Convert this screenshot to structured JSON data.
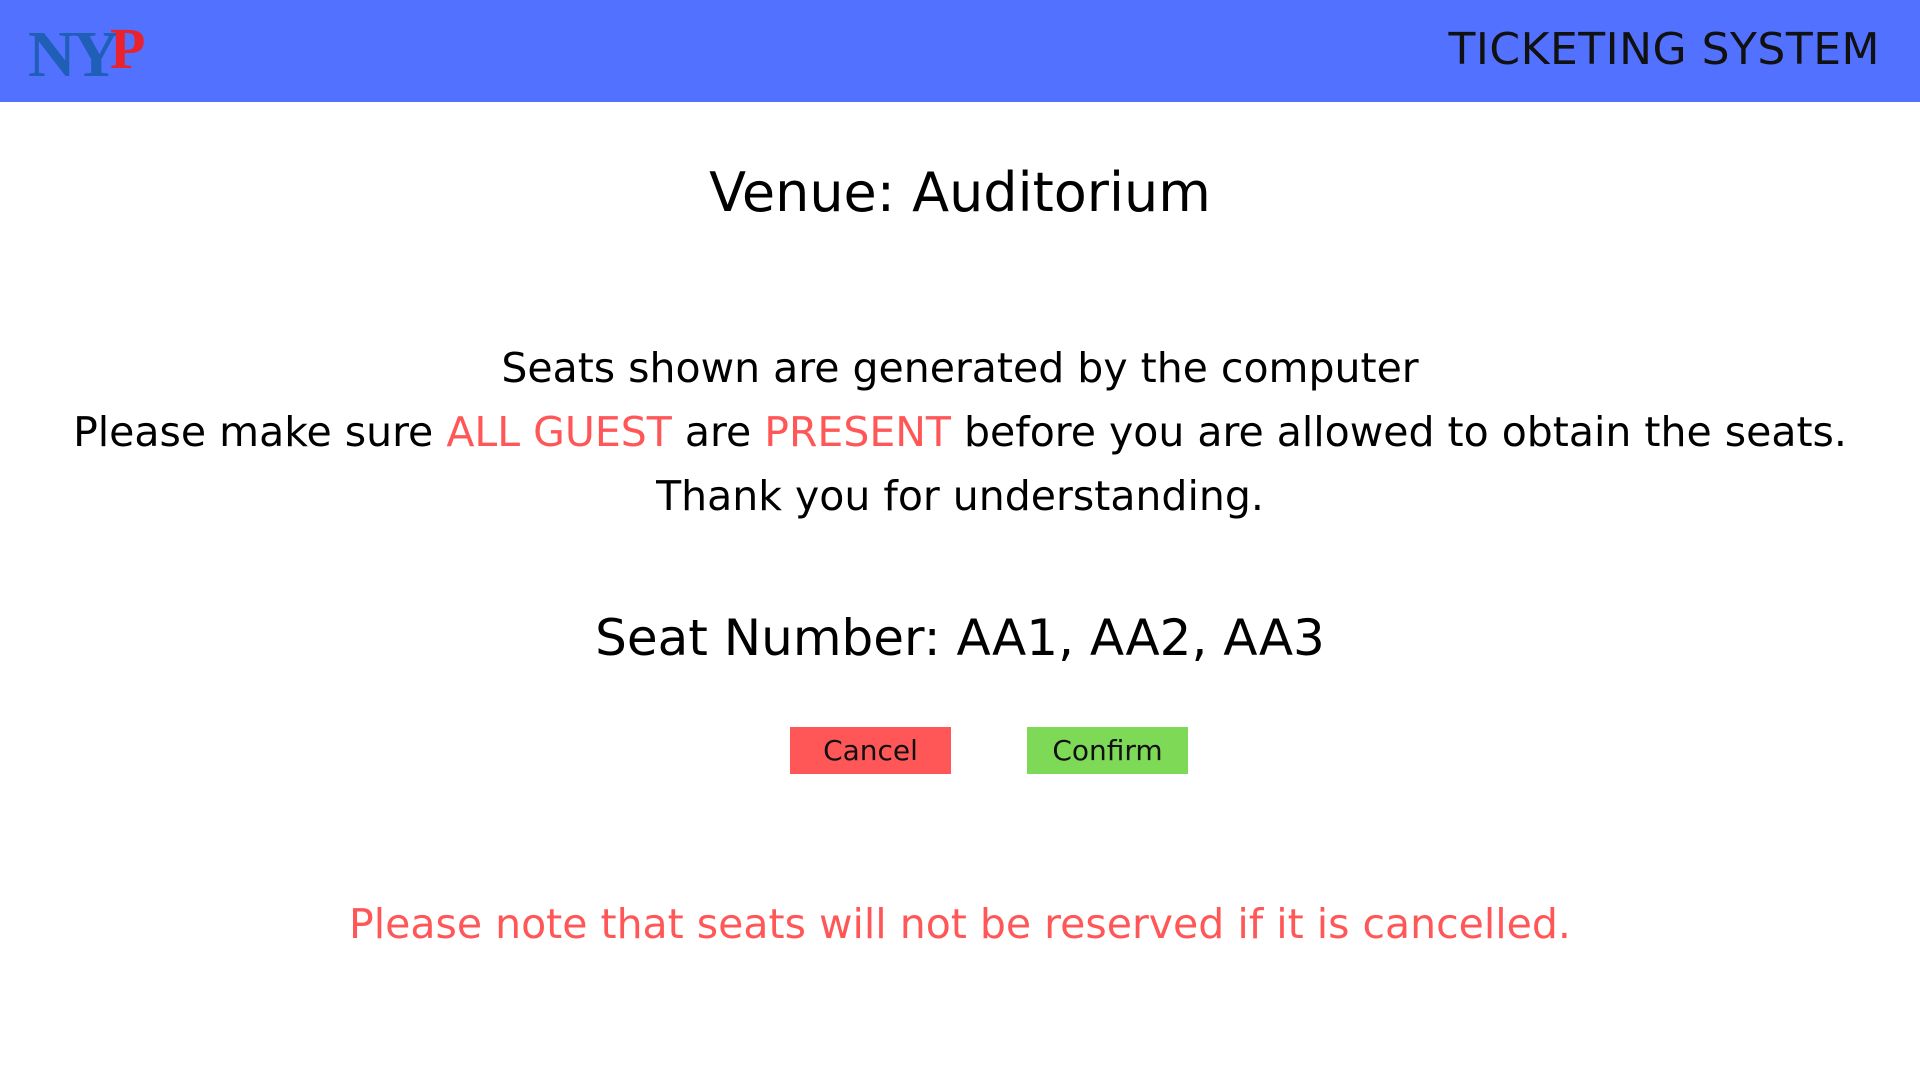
{
  "header": {
    "logo_text": "NYP",
    "title": "TICKETING SYSTEM"
  },
  "venue": {
    "text": "Venue: Auditorium"
  },
  "info": {
    "line1": "Seats shown are generated by the computer",
    "line2_part1": "Please make sure ",
    "line2_highlight1": "ALL GUEST",
    "line2_part2": " are ",
    "line2_highlight2": "PRESENT",
    "line2_part3": " before you are allowed to obtain the seats.",
    "line3": "Thank you for understanding."
  },
  "seat": {
    "text": "Seat Number: AA1, AA2, AA3"
  },
  "buttons": {
    "cancel_label": "Cancel",
    "confirm_label": "Confirm"
  },
  "note": {
    "text": "Please note that seats will not be reserved if it is cancelled."
  },
  "colors": {
    "header_bg": "#5271ff",
    "highlight": "#ff5757",
    "cancel_bg": "#ff5757",
    "confirm_bg": "#7ed957",
    "logo_blue": "#1f5fb8",
    "logo_red": "#e8232f"
  },
  "icons": {
    "logo": "nyp-logo"
  }
}
